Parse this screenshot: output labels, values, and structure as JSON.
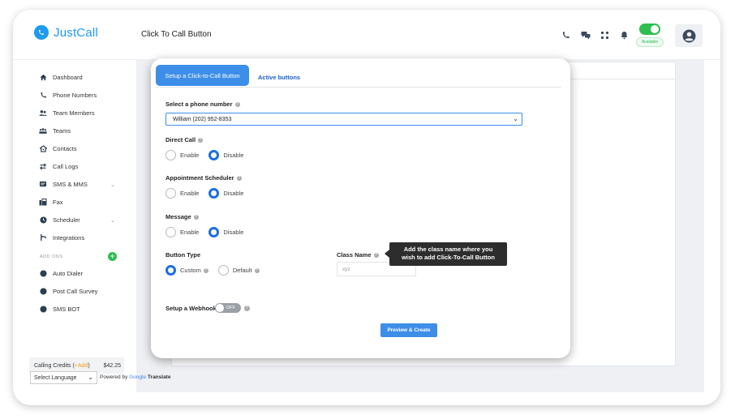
{
  "app": {
    "logo_text": "JustCall",
    "page_title": "Click To Call Button"
  },
  "header": {
    "icons": [
      "phone-icon",
      "chat-icon",
      "apps-grid-icon",
      "bell-icon"
    ],
    "status_toggle_on": true,
    "status_label": "Available",
    "accent": "#2cbe4e"
  },
  "sidebar": {
    "items": [
      {
        "label": "Dashboard",
        "icon": "home-icon"
      },
      {
        "label": "Phone Numbers",
        "icon": "phone-icon"
      },
      {
        "label": "Team Members",
        "icon": "users-icon"
      },
      {
        "label": "Teams",
        "icon": "teams-icon"
      },
      {
        "label": "Contacts",
        "icon": "contacts-icon"
      },
      {
        "label": "Call Logs",
        "icon": "call-logs-icon"
      },
      {
        "label": "SMS & MMS",
        "icon": "message-icon",
        "has_dropdown": true
      },
      {
        "label": "Fax",
        "icon": "fax-icon"
      },
      {
        "label": "Scheduler",
        "icon": "clock-icon",
        "has_dropdown": true
      },
      {
        "label": "Integrations",
        "icon": "integrations-icon"
      }
    ],
    "addons_label": "ADD ONS",
    "addons": [
      {
        "label": "Auto Dialer",
        "icon": "dot-icon"
      },
      {
        "label": "Post Call Survey",
        "icon": "dot-icon"
      },
      {
        "label": "SMS BOT",
        "icon": "dot-icon"
      }
    ],
    "credits_label": "Calling Credits (",
    "credits_add": "+Add",
    "credits_close": ")",
    "credits_amount": "$42.25",
    "language_select": "Select Language",
    "powered_by": "Powered by",
    "google": "Google",
    "translate": "Translate"
  },
  "modal": {
    "tabs": [
      {
        "label": "Setup a Click-to-Call Button",
        "active": true
      },
      {
        "label": "Active buttons",
        "active": false
      }
    ],
    "phone_label": "Select a phone number",
    "phone_value": "William (202) 952-8353",
    "direct_call_label": "Direct Call",
    "appointment_label": "Appointment Scheduler",
    "message_label": "Message",
    "enable_label": "Enable",
    "disable_label": "Disable",
    "button_type_label": "Button Type",
    "custom_label": "Custom",
    "default_label": "Default",
    "class_name_label": "Class Name",
    "class_name_placeholder": "xyz",
    "tooltip_line1": "Add the class name where you",
    "tooltip_line2": "wish to add Click-To-Call Button",
    "webhook_label": "Setup a Webhook",
    "webhook_toggle": "OFF",
    "preview_button": "Preview & Create"
  }
}
